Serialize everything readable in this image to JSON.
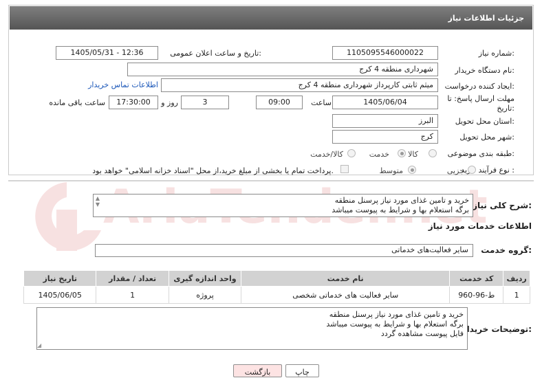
{
  "header": {
    "title": "جزئیات اطلاعات نیاز"
  },
  "form": {
    "need_number": {
      "label": "شماره نیاز:",
      "value": "1105095546000022"
    },
    "announce_datetime": {
      "label": "تاریخ و ساعت اعلان عمومی:",
      "value": "1405/05/31 - 12:36"
    },
    "buyer_org": {
      "label": "نام دستگاه خریدار:",
      "value": "شهرداری منطقه 4 کرج"
    },
    "creator": {
      "label": "ایجاد کننده درخواست:",
      "value": "میثم ثابتی کارپرداز شهرداری منطقه 4 کرج",
      "contact_link": "اطلاعات تماس خریدار"
    },
    "deadline": {
      "label_line1": "مهلت ارسال پاسخ: تا",
      "label_line2": "تاریخ:",
      "date": "1405/06/04",
      "time_label": "ساعت",
      "time": "09:00",
      "days": "3",
      "days_label": "روز و",
      "remaining_time": "17:30:00",
      "remaining_label": "ساعت باقی مانده"
    },
    "province": {
      "label": "استان محل تحویل:",
      "value": "البرز"
    },
    "city": {
      "label": "شهر محل تحویل:",
      "value": "کرج"
    },
    "category": {
      "label": "طبقه بندی موضوعی:",
      "options": [
        "کالا",
        "خدمت",
        "کالا/خدمت"
      ],
      "selected": "خدمت"
    },
    "purchase_type": {
      "label": "نوع فرآیند خرید :",
      "options": [
        "جزیی",
        "متوسط"
      ],
      "selected": "متوسط",
      "payment_note": "پرداخت تمام یا بخشی از مبلغ خرید،از محل \"اسناد خزانه اسلامی\" خواهد بود."
    }
  },
  "summary": {
    "label": "شرح کلی نیاز:",
    "text": "خرید و تامین غذای مورد نیاز پرسنل منطقه\nبرگه استعلام بها و شرایط به پیوست میباشد"
  },
  "services": {
    "section_title": "اطلاعات خدمات مورد نیاز",
    "group_label": "گروه خدمت:",
    "group_value": "سایر فعالیت‌های خدماتی",
    "columns": [
      "ردیف",
      "کد خدمت",
      "نام خدمت",
      "واحد اندازه گیری",
      "تعداد / مقدار",
      "تاریخ نیاز"
    ],
    "rows": [
      {
        "row": "1",
        "code": "ط-96-960",
        "name": "سایر فعالیت های خدماتی شخصی",
        "unit": "پروژه",
        "qty": "1",
        "date": "1405/06/05"
      }
    ]
  },
  "buyer_notes": {
    "label": "توضیحات خریدار:",
    "text": "خرید و تامین غذای مورد نیاز پرسنل منطقه\nبرگه استعلام بها و شرایط به پیوست میباشد\nفایل پیوست مشاهده گردد"
  },
  "buttons": {
    "print": "چاپ",
    "back": "بازگشت"
  },
  "watermark": {
    "text": "AriaTender.net"
  },
  "colors": {
    "header_bg": "#666666",
    "link": "#1a56b8",
    "back_button_bg": "#fde3e3",
    "watermark": "#c81e1e"
  }
}
